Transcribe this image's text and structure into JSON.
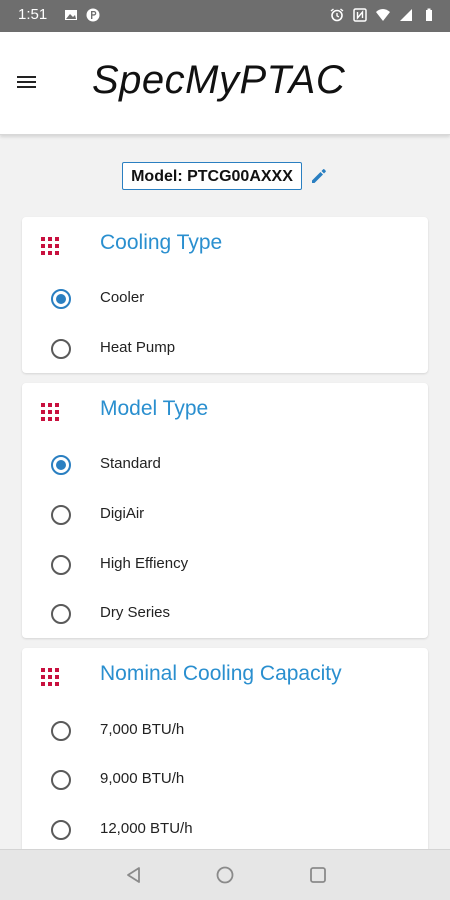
{
  "status_bar": {
    "time": "1:51",
    "icons": [
      "image-icon",
      "p-icon",
      "alarm-icon",
      "nfc-icon",
      "wifi-icon",
      "signal-icon",
      "battery-icon"
    ]
  },
  "app_bar": {
    "title": "SpecMyPTAC",
    "menu_icon": "menu-icon"
  },
  "model": {
    "label": "Model: PTCG00AXXX",
    "edit_icon": "edit-icon"
  },
  "colors": {
    "accent": "#2a8fcf",
    "grid_icon": "#c8103e",
    "radio_checked": "#2a7fc1"
  },
  "sections": [
    {
      "title": "Cooling Type",
      "options": [
        {
          "label": "Cooler",
          "checked": true
        },
        {
          "label": "Heat Pump",
          "checked": false
        }
      ]
    },
    {
      "title": "Model Type",
      "options": [
        {
          "label": "Standard",
          "checked": true
        },
        {
          "label": "DigiAir",
          "checked": false
        },
        {
          "label": "High Effiency",
          "checked": false
        },
        {
          "label": "Dry Series",
          "checked": false
        }
      ]
    },
    {
      "title": "Nominal Cooling Capacity",
      "options": [
        {
          "label": "7,000 BTU/h",
          "checked": false
        },
        {
          "label": "9,000 BTU/h",
          "checked": false
        },
        {
          "label": "12,000 BTU/h",
          "checked": false
        }
      ]
    }
  ],
  "nav_bar": {
    "icons": [
      "back-icon",
      "home-icon",
      "recents-icon"
    ]
  }
}
